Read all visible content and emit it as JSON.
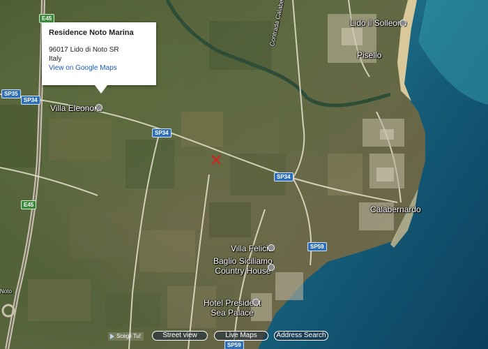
{
  "infowindow": {
    "title": "Residence Noto Marina",
    "address_line1": "96017 Lido di Noto SR",
    "address_line2": "Italy",
    "link": "View on Google Maps"
  },
  "places": {
    "villa_eleonora": "Villa Eleonora",
    "lido_solleone": "Lido il Solleone",
    "pisello": "Pisello",
    "calabernardo": "Calabernardo",
    "villa_felicia": "Villa Felicia",
    "baglio_line1": "Baglio Siciliamo",
    "baglio_line2": "Country House",
    "hotel_line1": "Hotel President",
    "hotel_line2": "Sea Palace",
    "contrada": "Contrada Calabernardo",
    "noto": "Noto"
  },
  "roads": {
    "e45_top": "E45",
    "e45_mid": "E45",
    "sp35": "SP35",
    "sp34_a": "SP34",
    "sp34_b": "SP34",
    "sp34_c": "SP34",
    "sp59": "SP59",
    "sp59_bottom": "SP59"
  },
  "controls": {
    "choose": "Scegli Tu!",
    "street_view": "Street view",
    "live_maps": "Live Maps",
    "address_search": "Address Search"
  },
  "colors": {
    "sea_deep": "#0b3f5c",
    "sea_shallow": "#2d8ba0",
    "land": "#5b6a3e",
    "road": "#e8e2cf",
    "infowindow_link": "#1a5bb8",
    "shield_blue": "#2e6fb8"
  }
}
